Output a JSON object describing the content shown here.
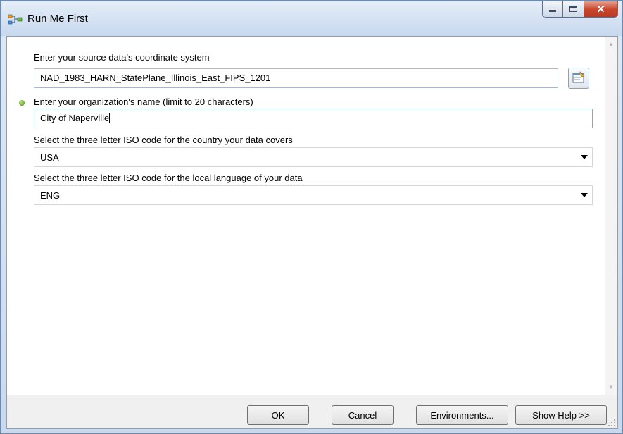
{
  "window": {
    "title": "Run Me First"
  },
  "form": {
    "coord_label": "Enter your source data's coordinate system",
    "coord_value": "NAD_1983_HARN_StatePlane_Illinois_East_FIPS_1201",
    "org_label": "Enter your organization's name (limit to 20 characters)",
    "org_value": "City of Naperville",
    "country_label": "Select the three letter ISO code for the country your data covers",
    "country_value": "USA",
    "language_label": "Select the three letter ISO code for the local language of your data",
    "language_value": "ENG"
  },
  "buttons": {
    "ok": "OK",
    "cancel": "Cancel",
    "environments": "Environments...",
    "show_help": "Show Help >>"
  },
  "icons": {
    "title": "model-tool-icon",
    "browse": "spatial-reference-properties-icon",
    "required": "required-parameter-dot"
  },
  "colors": {
    "required_dot": "#4d8d12",
    "close_button": "#c8452c"
  }
}
